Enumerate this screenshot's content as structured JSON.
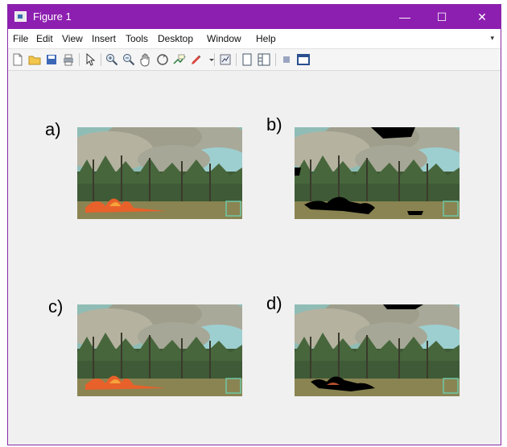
{
  "window": {
    "title": "Figure 1",
    "controls": {
      "minimize": "—",
      "maximize": "☐",
      "close": "✕"
    }
  },
  "menubar": {
    "items": [
      "File",
      "Edit",
      "View",
      "Insert",
      "Tools",
      "Desktop",
      "Window",
      "Help"
    ],
    "overflow": "▾"
  },
  "toolbar": {
    "icons": [
      "new-figure",
      "open-file",
      "save",
      "print",
      "pointer",
      "zoom-in",
      "zoom-out",
      "pan",
      "rotate-3d",
      "data-cursor",
      "brush",
      "link-plot",
      "hide-plot-tools",
      "show-plot-tools",
      "dock",
      "undock"
    ]
  },
  "panels": [
    {
      "label": "a)"
    },
    {
      "label": "b)"
    },
    {
      "label": "c)"
    },
    {
      "label": "d)"
    }
  ],
  "colors": {
    "titlebar": "#8d1fb0",
    "canvas": "#f0f0f0",
    "fire": "#e8612a",
    "smoke": "#a8a896",
    "sky": "#7fb9b6",
    "trees": "#3f5a36",
    "ground": "#8a8452"
  }
}
